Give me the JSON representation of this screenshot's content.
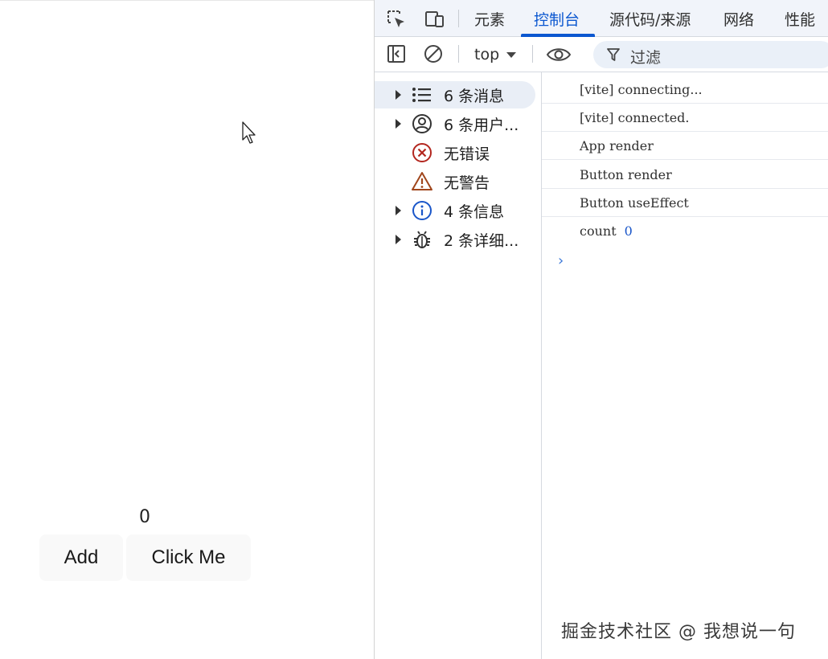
{
  "app": {
    "count": "0",
    "add_label": "Add",
    "click_label": "Click Me"
  },
  "devtools": {
    "tabs": [
      {
        "label": "元素",
        "active": false
      },
      {
        "label": "控制台",
        "active": true
      },
      {
        "label": "源代码/来源",
        "active": false
      },
      {
        "label": "网络",
        "active": false
      },
      {
        "label": "性能",
        "active": false
      }
    ],
    "icons": {
      "inspect": "inspect-element-icon",
      "device": "device-toolbar-icon",
      "sidebar_toggle": "sidebar-toggle-icon",
      "clear": "clear-console-icon",
      "eye": "live-expression-eye-icon",
      "filter": "filter-funnel-icon"
    },
    "context": "top",
    "filter_placeholder": "过滤",
    "colors": {
      "accent": "#0b57d0",
      "error": "#b3261e",
      "warning": "#a0461c",
      "info": "#1a56c9"
    }
  },
  "sidebar": {
    "items": [
      {
        "label": "6 条消息",
        "icon": "list-icon",
        "expandable": true,
        "selected": true
      },
      {
        "label": "6 条用户...",
        "icon": "user-icon",
        "expandable": true,
        "selected": false
      },
      {
        "label": "无错误",
        "icon": "error-icon",
        "expandable": false,
        "selected": false
      },
      {
        "label": "无警告",
        "icon": "warning-icon",
        "expandable": false,
        "selected": false
      },
      {
        "label": "4 条信息",
        "icon": "info-icon",
        "expandable": true,
        "selected": false
      },
      {
        "label": "2 条详细...",
        "icon": "bug-icon",
        "expandable": true,
        "selected": false
      }
    ]
  },
  "console": {
    "lines": [
      {
        "text": "[vite] connecting..."
      },
      {
        "text": "[vite] connected."
      },
      {
        "text": "App render"
      },
      {
        "text": "Button render"
      },
      {
        "text": "Button useEffect"
      },
      {
        "text": "count",
        "value": "0"
      }
    ],
    "prompt": "›"
  },
  "watermark": "掘金技术社区 @ 我想说一句"
}
